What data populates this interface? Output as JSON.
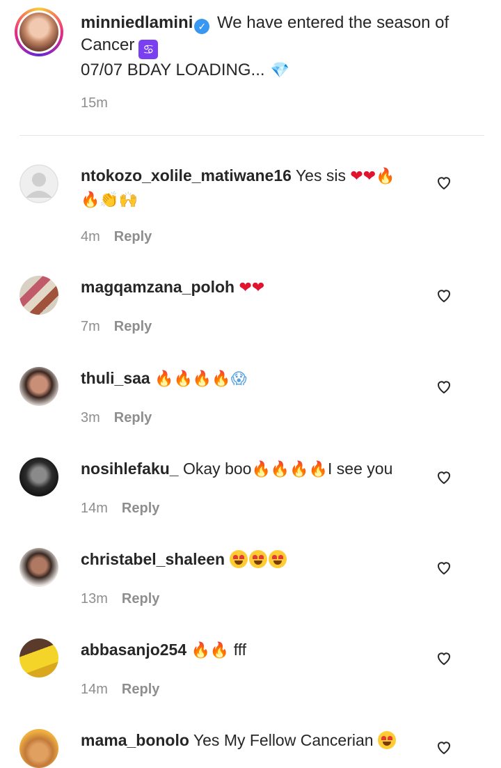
{
  "post": {
    "username": "minniedlamini",
    "caption_text": "We have entered the season of Cancer",
    "caption_line2": "07/07 BDAY LOADING...",
    "time": "15m"
  },
  "reply_label": "Reply",
  "comments": [
    {
      "username": "ntokozo_xolile_matiwane16",
      "text": "Yes sis",
      "time": "4m"
    },
    {
      "username": "magqamzana_poloh",
      "text": "",
      "time": "7m"
    },
    {
      "username": "thuli_saa",
      "text": "",
      "time": "3m"
    },
    {
      "username": "nosihlefaku_",
      "text": "Okay boo",
      "text_after": "I see you",
      "time": "14m"
    },
    {
      "username": "christabel_shaleen",
      "text": "",
      "time": "13m"
    },
    {
      "username": "abbasanjo254",
      "text": "fff",
      "time": "14m"
    },
    {
      "username": "mama_bonolo",
      "text": "Yes My Fellow Cancerian",
      "time": ""
    }
  ],
  "colors": {
    "accent": "#3897f0",
    "muted": "#8e8e8e",
    "text": "#262626"
  }
}
